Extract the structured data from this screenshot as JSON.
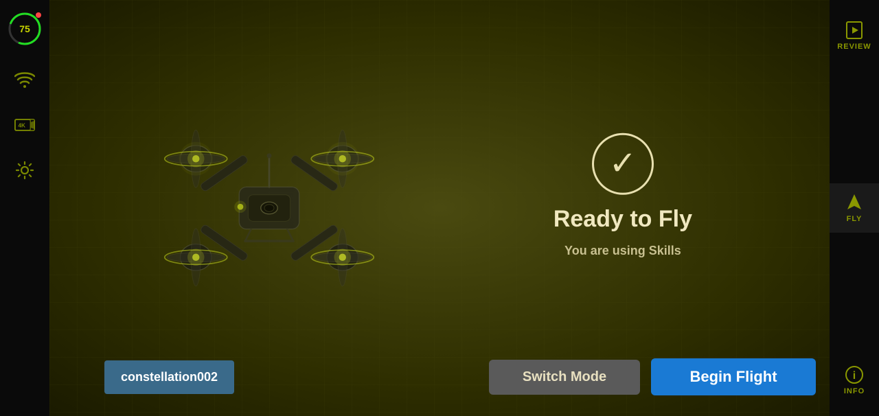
{
  "leftSidebar": {
    "battery": {
      "value": 75,
      "unit": "%",
      "color": "#22dd22",
      "bgColor": "#0a0a0a"
    },
    "icons": [
      {
        "name": "wifi",
        "label": "WiFi"
      },
      {
        "name": "4k",
        "label": "4K"
      },
      {
        "name": "settings",
        "label": "Settings"
      }
    ]
  },
  "main": {
    "droneStatus": {
      "checkmark": "✓",
      "title": "Ready to Fly",
      "subtitle": "You are using Skills"
    },
    "bottomControls": {
      "droneName": "constellation002",
      "switchModeLabel": "Switch Mode",
      "beginFlightLabel": "Begin Flight"
    }
  },
  "rightSidebar": {
    "items": [
      {
        "name": "review",
        "label": "REVIEW"
      },
      {
        "name": "fly",
        "label": "FLY"
      },
      {
        "name": "info",
        "label": "INFO"
      }
    ]
  },
  "colors": {
    "accent": "#c8d400",
    "background": "#3a3a00",
    "sidebarBg": "#0a0a0a",
    "droneBadge": "#3a6a8a",
    "switchBtn": "#5a5a5a",
    "beginBtn": "#1a7ad4",
    "textPrimary": "#f0e8c0",
    "textSecondary": "#c8c090",
    "iconColor": "#8a9800"
  }
}
